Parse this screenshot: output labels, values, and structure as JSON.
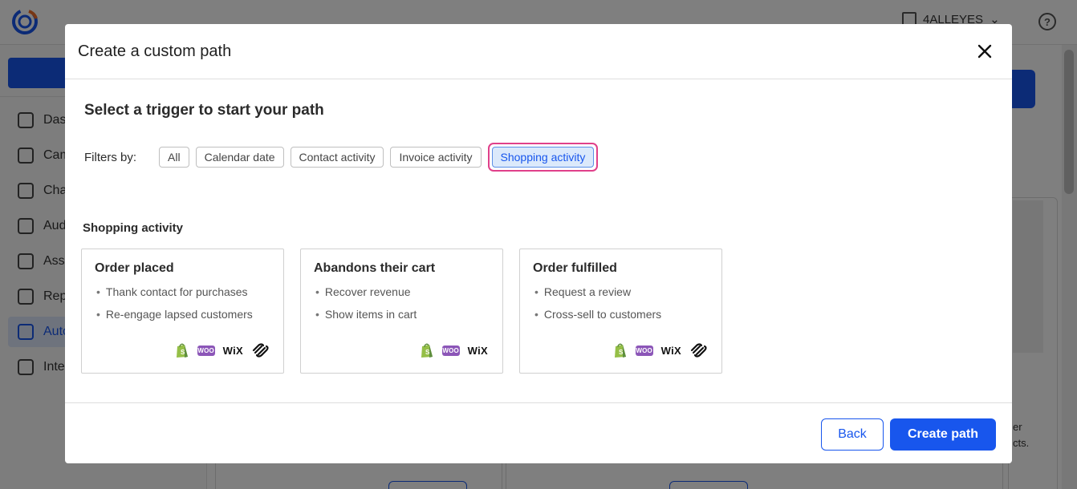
{
  "app": {
    "account_name": "4ALLEYES",
    "sidebar_items": [
      {
        "label": "Das",
        "icon": "dashboard-icon",
        "active": false
      },
      {
        "label": "Cam",
        "icon": "campaigns-icon",
        "active": false
      },
      {
        "label": "Cha",
        "icon": "channels-icon",
        "active": false
      },
      {
        "label": "Aud",
        "icon": "audience-icon",
        "active": false
      },
      {
        "label": "Asse",
        "icon": "assets-icon",
        "active": false
      },
      {
        "label": "Rep",
        "icon": "reports-icon",
        "active": false
      },
      {
        "label": "Auto",
        "icon": "automation-icon",
        "active": true
      },
      {
        "label": "Inte",
        "icon": "integrations-icon",
        "active": false
      }
    ],
    "bg_text_line1": "er",
    "bg_text_line2": "cts."
  },
  "modal": {
    "title": "Create a custom path",
    "heading": "Select a trigger to start your path",
    "filters_label": "Filters by:",
    "filters": [
      {
        "label": "All",
        "selected": false
      },
      {
        "label": "Calendar date",
        "selected": false
      },
      {
        "label": "Contact activity",
        "selected": false
      },
      {
        "label": "Invoice activity",
        "selected": false
      },
      {
        "label": "Shopping activity",
        "selected": true
      }
    ],
    "section_label": "Shopping activity",
    "cards": [
      {
        "title": "Order placed",
        "bullets": [
          "Thank contact for purchases",
          "Re-engage lapsed customers"
        ],
        "integrations": [
          "shopify",
          "woo",
          "wix",
          "squarespace"
        ]
      },
      {
        "title": "Abandons their cart",
        "bullets": [
          "Recover revenue",
          "Show items in cart"
        ],
        "integrations": [
          "shopify",
          "woo",
          "wix"
        ]
      },
      {
        "title": "Order fulfilled",
        "bullets": [
          "Request a review",
          "Cross-sell to customers"
        ],
        "integrations": [
          "shopify",
          "woo",
          "wix",
          "squarespace"
        ]
      }
    ],
    "back_label": "Back",
    "create_label": "Create path",
    "woo_text": "WOO",
    "wix_text": "WiX"
  },
  "colors": {
    "primary": "#1856ed",
    "highlight_ring": "#e0408a",
    "shopify_green": "#95bf47",
    "woo_purple": "#8c56b8"
  }
}
